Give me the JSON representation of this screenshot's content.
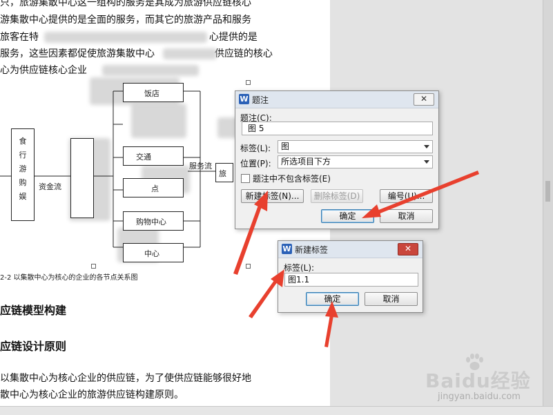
{
  "document": {
    "paragraphs": [
      "只，旅游集散中心这一组构的服务是其成为旅游供应链核心",
      "游集散中心提供的是全面的服务，而其它的旅游产品和服务",
      "旅客在特",
      "服务，这些因素都促使旅游集散中心",
      "心为供应链核心企业"
    ],
    "paragraph_tails": [
      "",
      "",
      "心提供的是",
      "供应链的核心",
      ""
    ],
    "diagram": {
      "left_box_chars": [
        "食",
        "行",
        "游",
        "购",
        "娱"
      ],
      "middle_label": "资金流",
      "right_boxes": [
        "饭店",
        "交通",
        "点",
        "购物中心",
        "中心"
      ],
      "flow_label": "服务流",
      "tourist_label": "旅"
    },
    "caption": "2-2 以集散中心为核心的企业的各节点关系图",
    "heading1": "应链模型构建",
    "heading2": "应链设计原则",
    "body_lines": [
      "以集散中心为核心企业的供应链，为了使供应链能够很好地",
      "散中心为核心企业的旅游供应链构建原则。"
    ]
  },
  "caption_dialog": {
    "title": "题注",
    "caption_label": "题注(C):",
    "caption_value": "图 5",
    "label_label": "标签(L):",
    "label_value": "图",
    "position_label": "位置(P):",
    "position_value": "所选项目下方",
    "exclude_label_text": "题注中不包含标签(E)",
    "new_label_button": "新建标签(N)...",
    "delete_label_button": "删除标签(D)",
    "numbering_button": "编号(U)...",
    "ok_button": "确定",
    "cancel_button": "取消",
    "close_glyph": "✕"
  },
  "new_label_dialog": {
    "title": "新建标签",
    "label_label": "标签(L):",
    "label_value": "图1.1",
    "ok_button": "确定",
    "cancel_button": "取消",
    "close_glyph": "✕"
  },
  "watermark": {
    "brand": "Baidu经验",
    "url": "jingyan.baidu.com"
  },
  "colors": {
    "arrow_red": "#e8402e",
    "wps_blue": "#2b61b7",
    "close_red": "#c9463d"
  }
}
